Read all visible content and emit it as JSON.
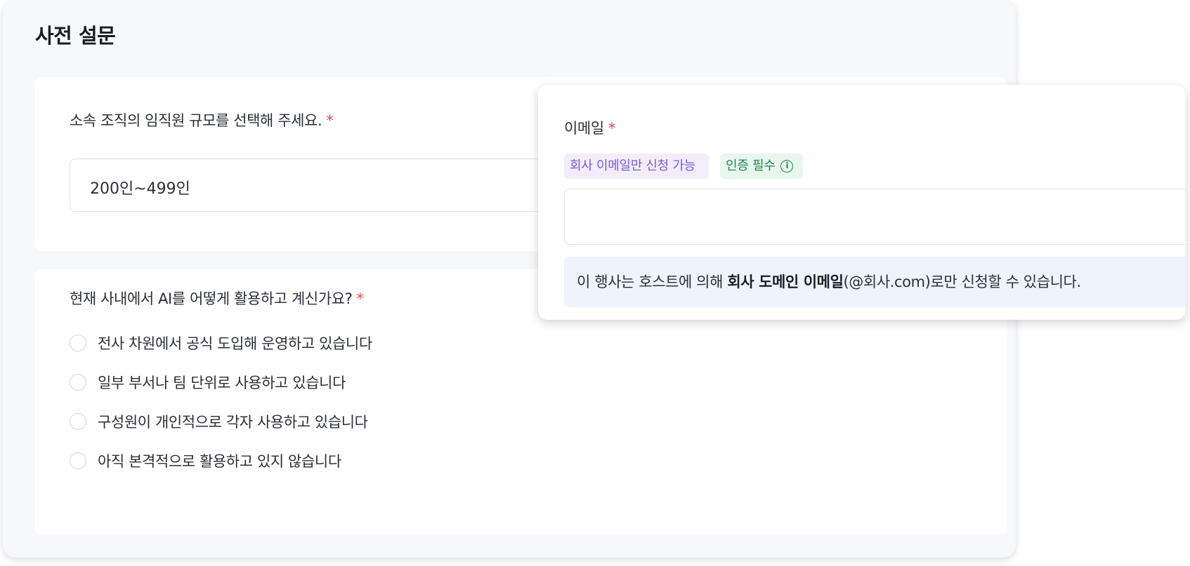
{
  "panel": {
    "title": "사전 설문"
  },
  "question1": {
    "label": "소속 조직의 임직원 규모를 선택해 주세요.",
    "required_mark": "*",
    "selected_value": "200인~499인"
  },
  "question2": {
    "label": "현재 사내에서 AI를 어떻게 활용하고 계신가요?",
    "required_mark": "*",
    "options": [
      "전사 차원에서 공식 도입해 운영하고 있습니다",
      "일부 부서나 팀 단위로 사용하고 있습니다",
      "구성원이 개인적으로 각자 사용하고 있습니다",
      "아직 본격적으로 활용하고 있지 않습니다"
    ]
  },
  "email_popup": {
    "label": "이메일",
    "required_mark": "*",
    "tags": {
      "company_only": "회사 이메일만 신청 가능",
      "verification": "인증 필수"
    },
    "input_value": "",
    "notice": {
      "prefix": "이 행사는 호스트에 의해 ",
      "bold": "회사 도메인 이메일",
      "suffix": "(@회사.com)로만 신청할 수 있습니다."
    }
  },
  "icons": {
    "info": "info-icon"
  },
  "colors": {
    "required": "#e5484d",
    "purple_tag_bg": "#f1edfb",
    "purple_tag_text": "#7a5bd6",
    "green_tag_bg": "#e8f6ee",
    "green_tag_text": "#1f8a4c",
    "notice_bg": "#eef3fd"
  }
}
